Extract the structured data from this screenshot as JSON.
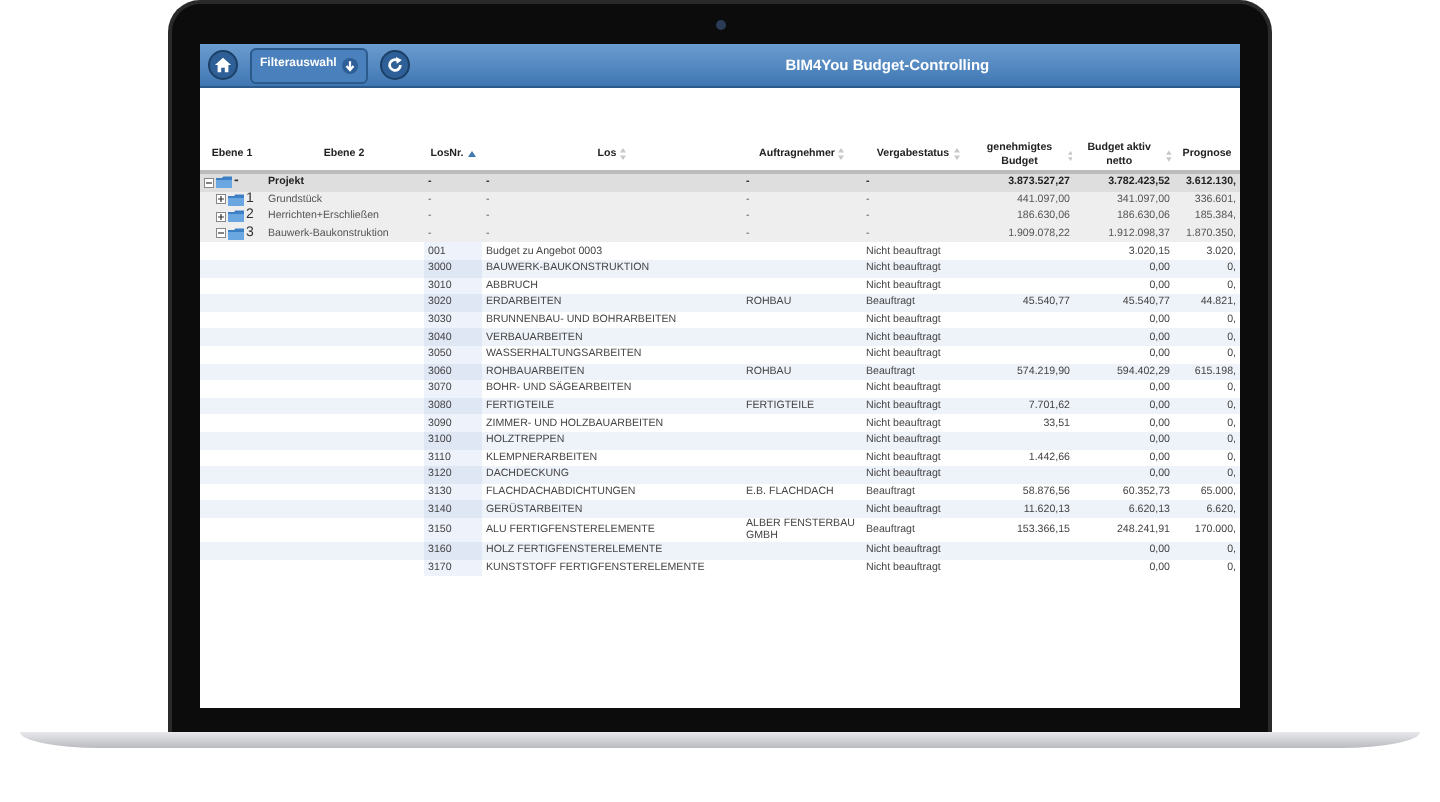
{
  "header": {
    "title": "BIM4You Budget-Controlling",
    "buttons": [
      {
        "kind": "home"
      },
      {
        "kind": "filter",
        "label": "Filterauswahl"
      },
      {
        "kind": "refresh"
      }
    ]
  },
  "table": {
    "columns": [
      {
        "label": "Ebene 1",
        "sortable": false
      },
      {
        "label": "Ebene 2",
        "sortable": false
      },
      {
        "label": "LosNr.",
        "sortable": true,
        "sorted": true
      },
      {
        "label": "Los",
        "sortable": true,
        "sorted": false
      },
      {
        "label": "Auftragnehmer",
        "sortable": true,
        "sorted": false
      },
      {
        "label": "Vergabestatus",
        "sortable": true,
        "sorted": false
      },
      {
        "label": "genehmigtes Budget",
        "sortable": true,
        "sorted": false
      },
      {
        "label": "Budget aktiv netto",
        "sortable": true,
        "sorted": false
      },
      {
        "label": "Prognose",
        "sortable": false
      }
    ],
    "rows": [
      {
        "ebene1": "-",
        "ebene2": "Projekt",
        "losnr": "-",
        "los": "-",
        "auftragnehmer": "-",
        "vergabestatus": "-",
        "budget": "3.873.527,27",
        "aktiv": "3.782.423,52",
        "prognose": "3.612.130,",
        "expanded": true,
        "children": [
          {
            "ebene1": "1",
            "ebene2": "Grundstück",
            "losnr": "-",
            "los": "-",
            "auftragnehmer": "-",
            "vergabestatus": "-",
            "budget": "441.097,00",
            "aktiv": "341.097,00",
            "prognose": "336.601,",
            "expanded": false
          },
          {
            "ebene1": "2",
            "ebene2": "Herrichten+Erschließen",
            "losnr": "-",
            "los": "-",
            "auftragnehmer": "-",
            "vergabestatus": "-",
            "budget": "186.630,06",
            "aktiv": "186.630,06",
            "prognose": "185.384,",
            "expanded": false
          },
          {
            "ebene1": "3",
            "ebene2": "Bauwerk-Baukonstruktion",
            "losnr": "-",
            "los": "-",
            "auftragnehmer": "-",
            "vergabestatus": "-",
            "budget": "1.909.078,22",
            "aktiv": "1.912.098,37",
            "prognose": "1.870.350,",
            "expanded": true,
            "children": [
              {
                "losnr": "001",
                "los": "Budget zu Angebot 0003",
                "vergabestatus": "Nicht beauftragt",
                "aktiv": "3.020,15",
                "prognose": "3.020,"
              },
              {
                "losnr": "3000",
                "los": "BAUWERK-BAUKONSTRUKTION",
                "vergabestatus": "Nicht beauftragt",
                "aktiv": "0,00",
                "prognose": "0,"
              },
              {
                "losnr": "3010",
                "los": "ABBRUCH",
                "vergabestatus": "Nicht beauftragt",
                "aktiv": "0,00",
                "prognose": "0,"
              },
              {
                "losnr": "3020",
                "los": "ERDARBEITEN",
                "auftragnehmer": "ROHBAU",
                "vergabestatus": "Beauftragt",
                "budget": "45.540,77",
                "aktiv": "45.540,77",
                "prognose": "44.821,"
              },
              {
                "losnr": "3030",
                "los": "BRUNNENBAU- UND BOHRARBEITEN",
                "vergabestatus": "Nicht beauftragt",
                "aktiv": "0,00",
                "prognose": "0,"
              },
              {
                "losnr": "3040",
                "los": "VERBAUARBEITEN",
                "vergabestatus": "Nicht beauftragt",
                "aktiv": "0,00",
                "prognose": "0,"
              },
              {
                "losnr": "3050",
                "los": "WASSERHALTUNGSARBEITEN",
                "vergabestatus": "Nicht beauftragt",
                "aktiv": "0,00",
                "prognose": "0,"
              },
              {
                "losnr": "3060",
                "los": "ROHBAUARBEITEN",
                "auftragnehmer": "ROHBAU",
                "vergabestatus": "Beauftragt",
                "budget": "574.219,90",
                "aktiv": "594.402,29",
                "prognose": "615.198,"
              },
              {
                "losnr": "3070",
                "los": "BOHR- UND SÄGEARBEITEN",
                "vergabestatus": "Nicht beauftragt",
                "aktiv": "0,00",
                "prognose": "0,"
              },
              {
                "losnr": "3080",
                "los": "FERTIGTEILE",
                "auftragnehmer": "FERTIGTEILE",
                "vergabestatus": "Nicht beauftragt",
                "budget": "7.701,62",
                "aktiv": "0,00",
                "prognose": "0,"
              },
              {
                "losnr": "3090",
                "los": "ZIMMER- UND HOLZBAUARBEITEN",
                "vergabestatus": "Nicht beauftragt",
                "budget": "33,51",
                "aktiv": "0,00",
                "prognose": "0,"
              },
              {
                "losnr": "3100",
                "los": "HOLZTREPPEN",
                "vergabestatus": "Nicht beauftragt",
                "aktiv": "0,00",
                "prognose": "0,"
              },
              {
                "losnr": "3110",
                "los": "KLEMPNERARBEITEN",
                "vergabestatus": "Nicht beauftragt",
                "budget": "1.442,66",
                "aktiv": "0,00",
                "prognose": "0,"
              },
              {
                "losnr": "3120",
                "los": "DACHDECKUNG",
                "vergabestatus": "Nicht beauftragt",
                "aktiv": "0,00",
                "prognose": "0,"
              },
              {
                "losnr": "3130",
                "los": "FLACHDACHABDICHTUNGEN",
                "auftragnehmer": "E.B. FLACHDACH",
                "vergabestatus": "Beauftragt",
                "budget": "58.876,56",
                "aktiv": "60.352,73",
                "prognose": "65.000,"
              },
              {
                "losnr": "3140",
                "los": "GERÜSTARBEITEN",
                "vergabestatus": "Nicht beauftragt",
                "budget": "11.620,13",
                "aktiv": "6.620,13",
                "prognose": "6.620,"
              },
              {
                "losnr": "3150",
                "los": "ALU FERTIGFENSTERELEMENTE",
                "auftragnehmer": "ALBER FENSTERBAU GMBH",
                "vergabestatus": "Beauftragt",
                "budget": "153.366,15",
                "aktiv": "248.241,91",
                "prognose": "170.000,"
              },
              {
                "losnr": "3160",
                "los": "HOLZ FERTIGFENSTERELEMENTE",
                "vergabestatus": "Nicht beauftragt",
                "aktiv": "0,00",
                "prognose": "0,"
              },
              {
                "losnr": "3170",
                "los": "KUNSTSTOFF FERTIGFENSTERELEMENTE",
                "vergabestatus": "Nicht beauftragt",
                "aktiv": "0,00",
                "prognose": "0,"
              }
            ]
          }
        ]
      }
    ]
  }
}
